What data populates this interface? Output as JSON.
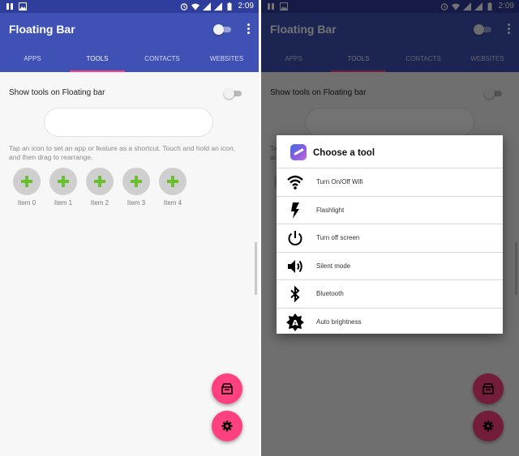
{
  "status_bar": {
    "time": "2:09"
  },
  "app": {
    "title": "Floating Bar"
  },
  "tabs": [
    {
      "label": "APPS"
    },
    {
      "label": "TOOLS",
      "active": true
    },
    {
      "label": "CONTACTS"
    },
    {
      "label": "WEBSITES"
    }
  ],
  "settings": {
    "show_tools_label": "Show tools on Floating bar",
    "help_text": "Tap an icon to set an app or feature as a shortcut. Touch and hold an icon, and then drag to rearrange."
  },
  "items": [
    {
      "label": "Item 0"
    },
    {
      "label": "Item 1"
    },
    {
      "label": "Item 2"
    },
    {
      "label": "Item 3"
    },
    {
      "label": "Item 4"
    }
  ],
  "dialog": {
    "title": "Choose a tool",
    "options": [
      {
        "label": "Turn On/Off Wifi",
        "icon": "wifi-icon"
      },
      {
        "label": "Flashlight",
        "icon": "flashlight-icon"
      },
      {
        "label": "Turn off screen",
        "icon": "power-icon"
      },
      {
        "label": "Silent mode",
        "icon": "volume-icon"
      },
      {
        "label": "Bluetooth",
        "icon": "bluetooth-icon"
      },
      {
        "label": "Auto brightness",
        "icon": "auto-brightness-icon"
      }
    ]
  },
  "fabs": [
    {
      "icon": "store-icon"
    },
    {
      "icon": "gear-icon"
    }
  ],
  "colors": {
    "primary": "#3f51b5",
    "status_bar": "#2f3d9c",
    "accent": "#ff4081",
    "item_plus": "#6abf30"
  }
}
